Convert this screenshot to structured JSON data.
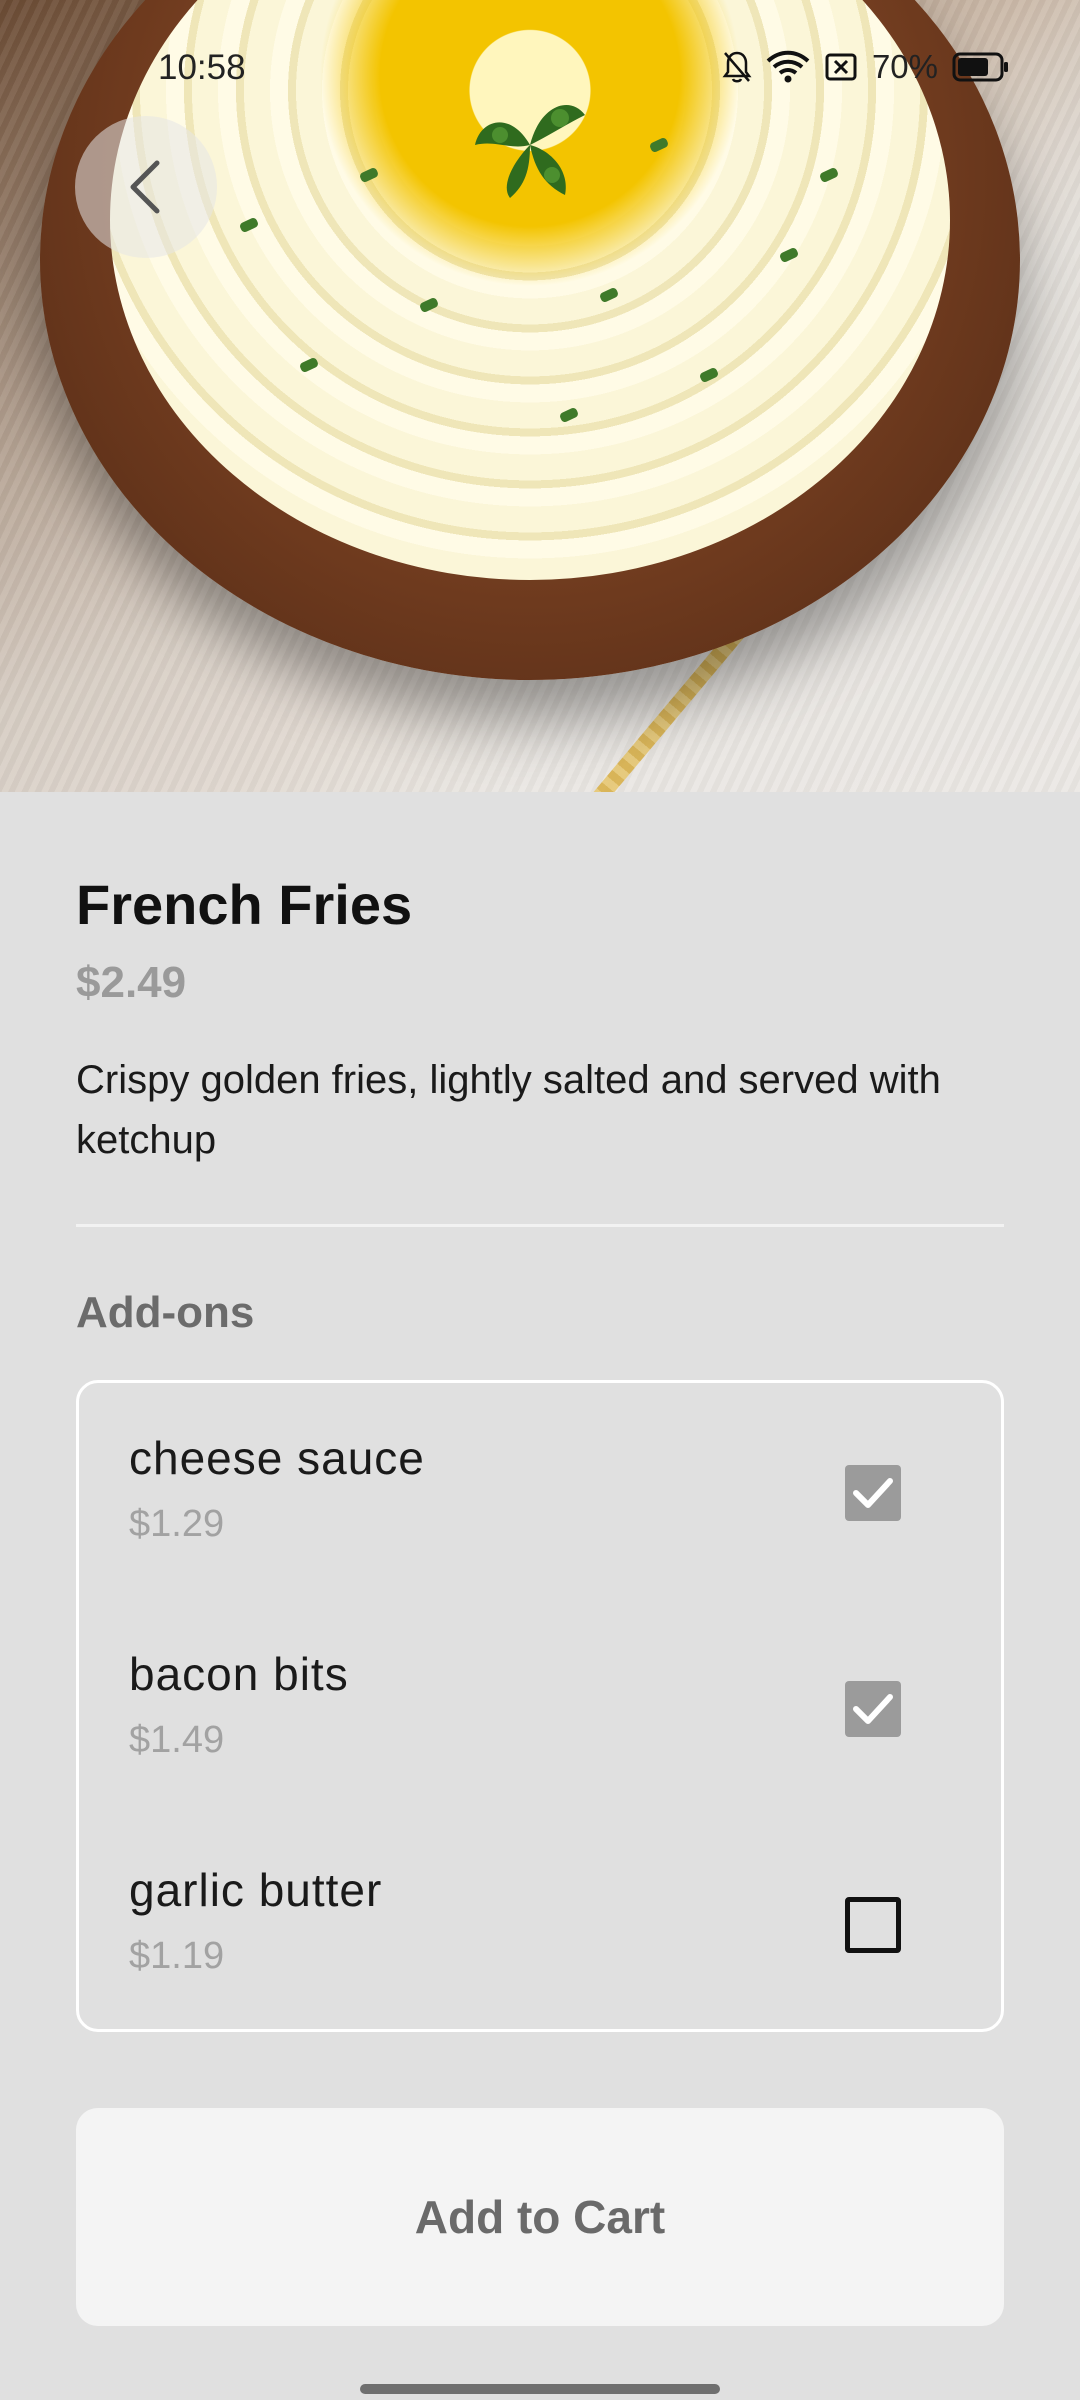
{
  "status_bar": {
    "time": "10:58",
    "battery_percent": "70%",
    "icons": [
      "bell-off-icon",
      "wifi-icon",
      "sim-blocked-icon",
      "battery-icon"
    ]
  },
  "hero": {
    "back_icon": "chevron-left-icon"
  },
  "item": {
    "title": "French Fries",
    "price": "$2.49",
    "description": "Crispy golden fries, lightly salted and served with ketchup"
  },
  "addons": {
    "label": "Add-ons",
    "items": [
      {
        "name": "cheese sauce",
        "price": "$1.29",
        "checked": true
      },
      {
        "name": "bacon bits",
        "price": "$1.49",
        "checked": true
      },
      {
        "name": "garlic butter",
        "price": "$1.19",
        "checked": false
      }
    ]
  },
  "cart_button": {
    "label": "Add to Cart"
  },
  "colors": {
    "background": "#e0e0e0",
    "checkbox_checked": "#9b9b9b",
    "price_text": "#9a9a9a",
    "button_bg": "#f4f4f4"
  }
}
